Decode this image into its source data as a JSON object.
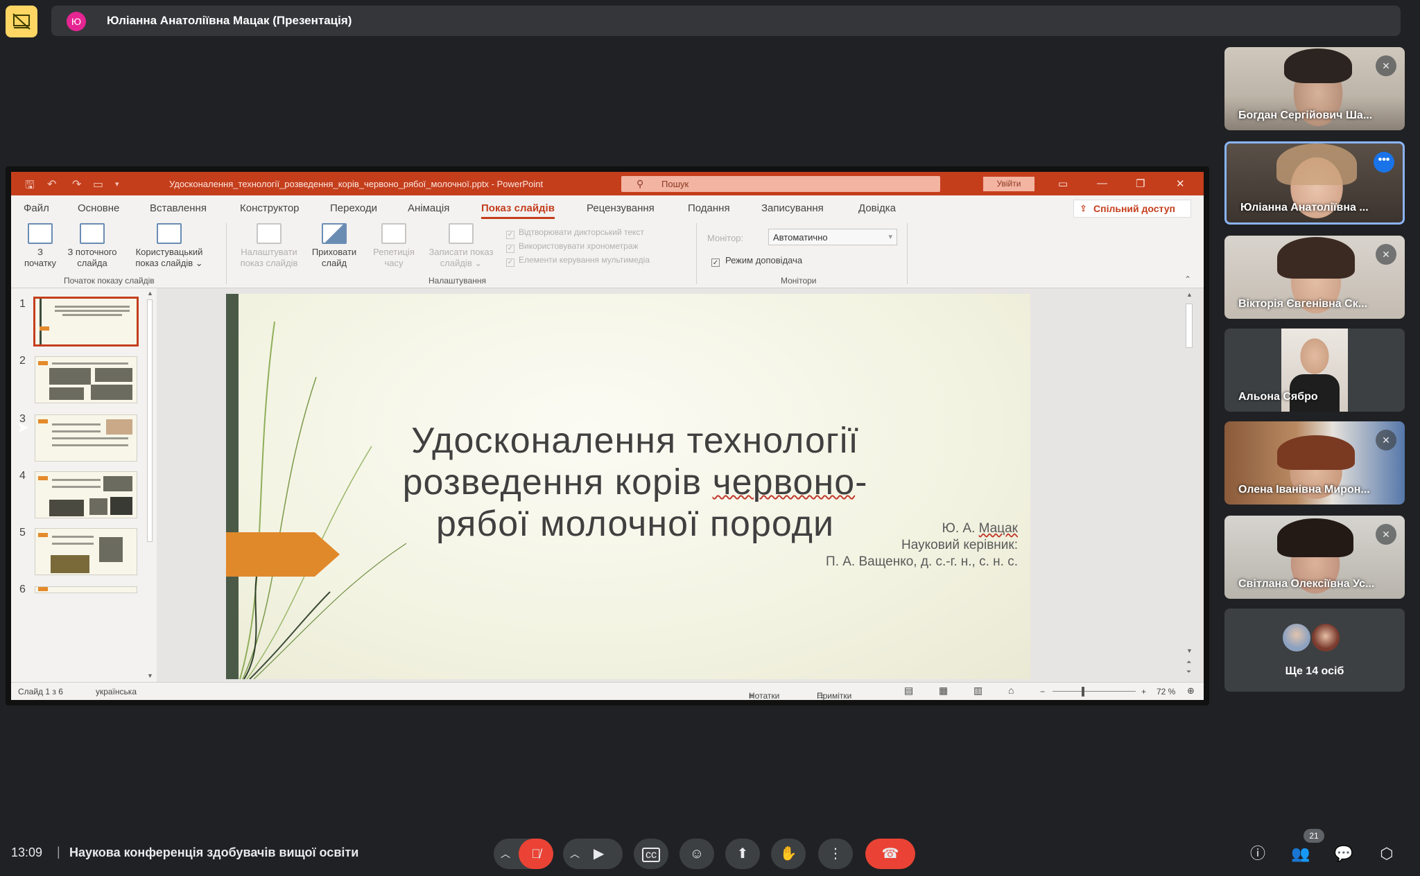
{
  "presenter": {
    "initial": "Ю",
    "label": "Юліанна Анатоліївна Мацак (Презентація)"
  },
  "powerpoint": {
    "doc_title": "Удосконалення_технології_розведення_корів_червоно_рябої_молочної.pptx  -  PowerPoint",
    "search_placeholder": "Пошук",
    "signin": "Увійти",
    "tabs": [
      "Файл",
      "Основне",
      "Вставлення",
      "Конструктор",
      "Переходи",
      "Анімація",
      "Показ слайдів",
      "Рецензування",
      "Подання",
      "Записування",
      "Довідка"
    ],
    "active_tab": "Показ слайдів",
    "share_label": "Спільний доступ",
    "ribbon": {
      "btn_from_start_1": "З",
      "btn_from_start_2": "початку",
      "btn_from_current_1": "З поточного",
      "btn_from_current_2": "слайда",
      "btn_custom_1": "Користувацький",
      "btn_custom_2": "показ слайдів ⌄",
      "group_start": "Початок показу слайдів",
      "btn_setup_1": "Налаштувати",
      "btn_setup_2": "показ слайдів",
      "btn_hide_1": "Приховати",
      "btn_hide_2": "слайд",
      "btn_rehearse_1": "Репетиція",
      "btn_rehearse_2": "часу",
      "btn_record_1": "Записати показ",
      "btn_record_2": "слайдів ⌄",
      "chk_narration": "Відтворювати дикторський текст",
      "chk_timings": "Використовувати хронометраж",
      "chk_media": "Елементи керування мультимедіа",
      "group_setup": "Налаштування",
      "monitor_label": "Монітор:",
      "monitor_value": "Автоматично",
      "presenter_view": "Режим доповідача",
      "group_monitors": "Монітори"
    },
    "thumbnail_numbers": [
      "1",
      "2",
      "3",
      "4",
      "5",
      "6"
    ],
    "slide": {
      "title_line1": "Удосконалення технології",
      "title_line2a": "розведення корів ",
      "title_line2b": "червоно",
      "title_line2c": "-",
      "title_line3": "рябої молочної породи",
      "author_prefix": "Ю. А. ",
      "author_name": "Мацак",
      "supervisor_label": "Науковий керівник:",
      "supervisor": "П. А. Ващенко, д. с.-г. н., с. н. с."
    },
    "status": {
      "slide_count": "Слайд 1 з 6",
      "language": "українська",
      "notes": "Нотатки",
      "comments": "Примітки",
      "zoom": "72 %"
    }
  },
  "participants": [
    {
      "name": "Богдан Сергійович Ша...",
      "muted": true
    },
    {
      "name": "Юліанна Анатоліївна ...",
      "muted": false
    },
    {
      "name": "Вікторія Євгенівна Ск...",
      "muted": true
    },
    {
      "name": "Альона Сябро",
      "muted": false
    },
    {
      "name": "Олена Іванівна Мирон...",
      "muted": true
    },
    {
      "name": "Світлана Олексіївна Ус...",
      "muted": true
    }
  ],
  "more_participants": "Ще 14 осіб",
  "bottom": {
    "time": "13:09",
    "separator": "|",
    "meeting_title": "Наукова конференція здобувачів вищої освіти",
    "people_count": "21"
  },
  "colors": {
    "ppt_accent": "#c43e1c",
    "meet_bg": "#202124",
    "end_call": "#ea4335",
    "active_speaker": "#8ab4f8"
  }
}
